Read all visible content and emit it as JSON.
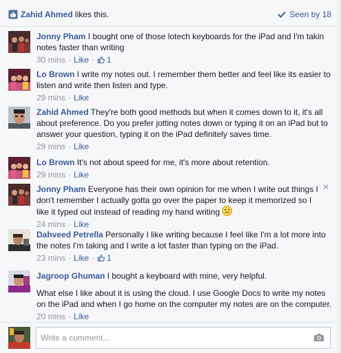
{
  "header": {
    "liker": "Zahid Ahmed",
    "likes_suffix": " likes this.",
    "seen_label": "Seen by 18"
  },
  "comments": [
    {
      "author": "Jonny Pham",
      "text": " I bought one of those lotech keyboards for the iPad and I'm takin notes faster than writing",
      "time": "30 mins",
      "like_label": "Like",
      "like_count": "1"
    },
    {
      "author": "Lo Brown",
      "text": " I write my notes out. I remember them better and feel like its easier to listen and write then listen and type.",
      "time": "29 mins",
      "like_label": "Like"
    },
    {
      "author": "Zahid Ahmed",
      "text": " They're both good methods but when it comes down to it, it's all about preference. Do you prefer jotting notes down or typing it on an iPad but to answer your question, typing it on the iPad definitely saves time.",
      "time": "29 mins",
      "like_label": "Like"
    },
    {
      "author": "Lo Brown",
      "text": " It's not about speed for me, it's more about retention.",
      "time": "29 mins",
      "like_label": "Like"
    },
    {
      "author": "Jonny Pham",
      "text": " Everyone has their own opinion for me when I write out things I don't remember I actually gotta go over the paper to keep it memorized so I like it typed out instead of reading my hand writing ",
      "time": "24 mins",
      "like_label": "Like",
      "close_glyph": "✕"
    },
    {
      "author": "Dahveed Petrella",
      "text": " Personally I like writing because I feel like I'm a lot more into the notes I'm taking and I write a lot faster than typing on the iPad.",
      "time": "23 mins",
      "like_label": "Like",
      "like_count": "1"
    },
    {
      "author": "Jagroop Ghuman",
      "text": " I bought a keyboard with mine, very helpful.",
      "text2": "What else I like about it is using the cloud. I use Google Docs to write my notes on the iPad and when I go home on the computer my notes are on the computer.",
      "time": "20 mins",
      "like_label": "Like"
    }
  ],
  "meta_separator": "·",
  "composer": {
    "placeholder": "Write a comment..."
  },
  "colors": {
    "link": "#3b5998",
    "muted": "#90949c",
    "background": "#f6f7f9"
  },
  "icons": [
    "thumbs-up-icon",
    "checkmark-icon",
    "close-icon",
    "camera-icon",
    "sad-emoji-icon"
  ]
}
